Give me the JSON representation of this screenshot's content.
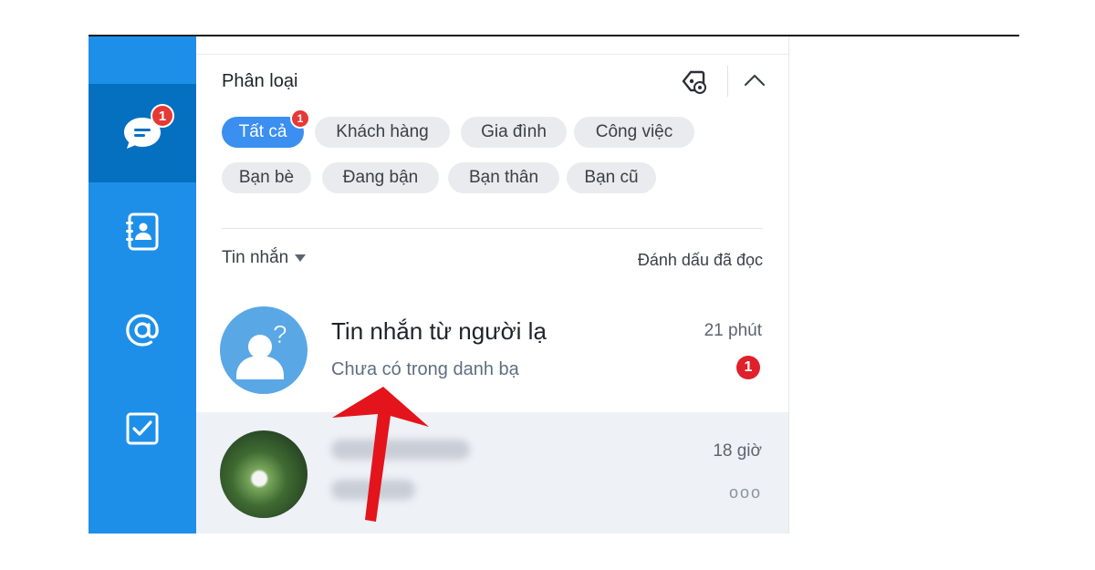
{
  "sidebar": {
    "nav": [
      {
        "id": "messages",
        "icon": "chat-bubble-icon",
        "active": true,
        "badge": "1"
      },
      {
        "id": "contacts",
        "icon": "contact-book-icon",
        "active": false
      },
      {
        "id": "mentions",
        "icon": "at-sign-icon",
        "active": false
      },
      {
        "id": "todo",
        "icon": "checkbox-icon",
        "active": false
      }
    ]
  },
  "categories": {
    "title": "Phân loại",
    "chips": [
      {
        "label": "Tất cả",
        "active": true,
        "badge": "1"
      },
      {
        "label": "Khách hàng"
      },
      {
        "label": "Gia đình"
      },
      {
        "label": "Công việc"
      },
      {
        "label": "Bạn bè"
      },
      {
        "label": "Đang bận"
      },
      {
        "label": "Bạn thân"
      },
      {
        "label": "Bạn cũ"
      }
    ]
  },
  "messages": {
    "filter_label": "Tin nhắn",
    "mark_read_label": "Đánh dấu đã đọc",
    "conversations": [
      {
        "name": "Tin nhắn từ người lạ",
        "subtitle": "Chưa có trong danh bạ",
        "time": "21 phút",
        "unread": "1"
      },
      {
        "time": "18 giờ",
        "more": "ooo"
      }
    ]
  },
  "colors": {
    "sidebar": "#1e8fe9",
    "sidebar_active": "#0670c0",
    "chip_active": "#3a8ff0",
    "badge": "#e53935",
    "arrow": "#e3141b"
  }
}
